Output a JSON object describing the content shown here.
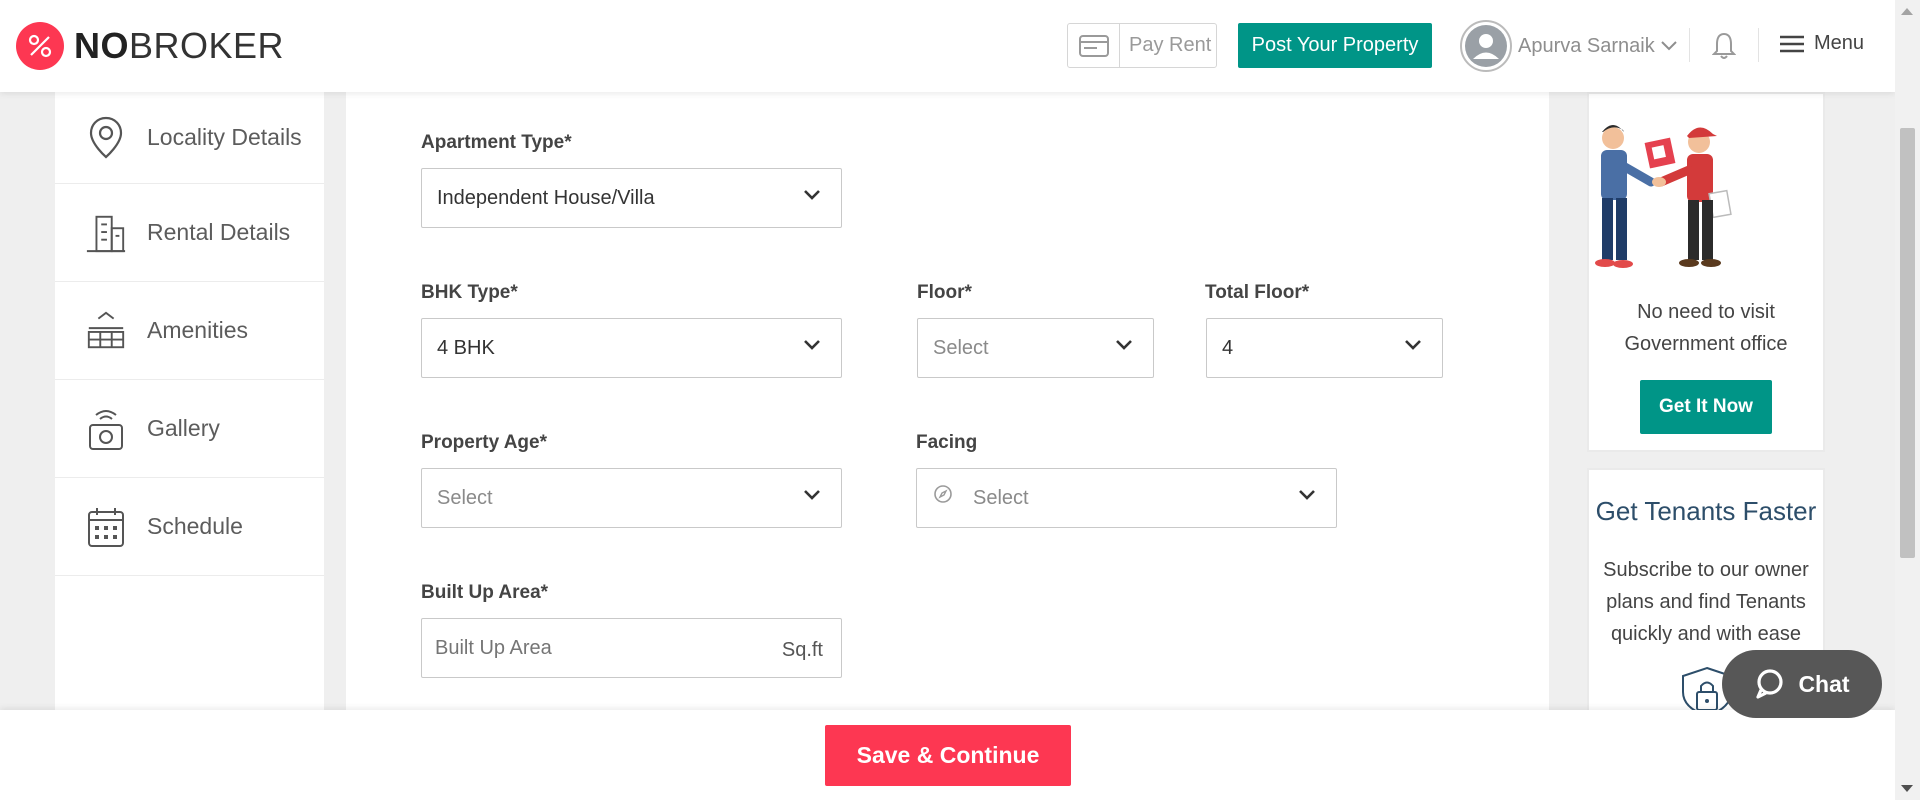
{
  "header": {
    "logo_bold": "NO",
    "logo_rest": "BROKER",
    "pay_rent_label": "Pay Rent",
    "post_property_label": "Post Your Property",
    "user_name": "Apurva Sarnaik",
    "menu_label": "Menu"
  },
  "sidebar": {
    "items": [
      {
        "label": "Locality Details",
        "icon": "location-pin-icon"
      },
      {
        "label": "Rental Details",
        "icon": "building-icon"
      },
      {
        "label": "Amenities",
        "icon": "amenities-icon"
      },
      {
        "label": "Gallery",
        "icon": "camera-icon"
      },
      {
        "label": "Schedule",
        "icon": "calendar-icon"
      }
    ]
  },
  "form": {
    "apartment_type": {
      "label": "Apartment Type*",
      "value": "Independent House/Villa"
    },
    "bhk_type": {
      "label": "BHK Type*",
      "value": "4 BHK"
    },
    "floor": {
      "label": "Floor*",
      "value": "Select"
    },
    "total_floor": {
      "label": "Total Floor*",
      "value": "4"
    },
    "property_age": {
      "label": "Property Age*",
      "value": "Select"
    },
    "facing": {
      "label": "Facing",
      "value": "Select"
    },
    "built_up_area": {
      "label": "Built Up Area*",
      "placeholder": "Built Up Area",
      "unit": "Sq.ft"
    }
  },
  "promo": {
    "visit_line1": "No need to visit",
    "visit_line2": "Government office",
    "get_it_now": "Get It Now",
    "tenants_title": "Get Tenants Faster",
    "tenants_line1": "Subscribe to our owner",
    "tenants_line2": "plans and find Tenants",
    "tenants_line3": "quickly and with ease"
  },
  "footer": {
    "save_label": "Save & Continue"
  },
  "chat": {
    "label": "Chat"
  },
  "colors": {
    "brand_red": "#fd3752",
    "brand_teal": "#009587"
  }
}
